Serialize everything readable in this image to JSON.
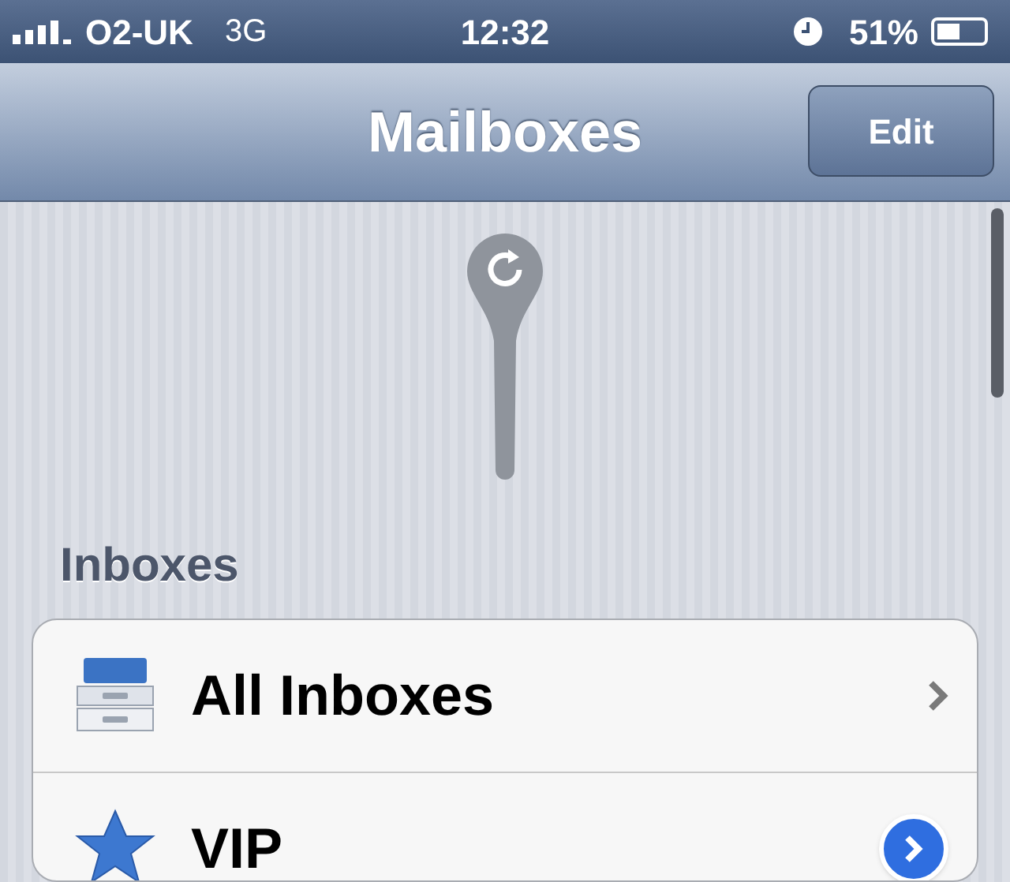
{
  "status_bar": {
    "carrier": "O2-UK",
    "network": "3G",
    "time": "12:32",
    "battery": "51%"
  },
  "nav_bar": {
    "title": "Mailboxes",
    "edit_button": "Edit"
  },
  "section": {
    "header": "Inboxes",
    "rows": [
      {
        "label": "All Inboxes",
        "kind": "inbox"
      },
      {
        "label": "VIP",
        "kind": "star"
      }
    ]
  }
}
